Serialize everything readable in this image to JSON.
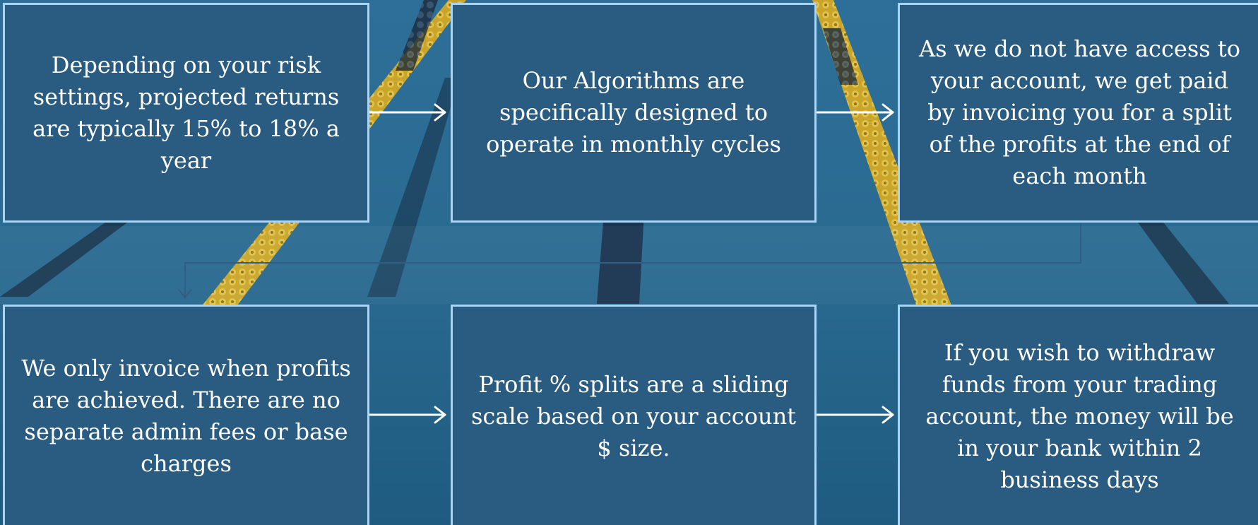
{
  "steps": [
    {
      "text": "Depending on your risk settings, projected returns are typically 15% to 18% a year"
    },
    {
      "text": "Our Algorithms are specifically designed to operate in monthly cycles"
    },
    {
      "text": "As we do not have access to your account, we get paid by invoicing you for a split of the profits at the end of each month"
    },
    {
      "text": "We only invoice when profits are achieved. There are no separate admin fees or base charges"
    },
    {
      "text": "Profit % splits are a sliding scale based on your account $ size."
    },
    {
      "text": "If you wish to withdraw funds from your trading account, the money will be in your bank within 2 business days"
    }
  ],
  "colors": {
    "card_fill": "#2a5b80",
    "card_border": "#a8d4f5",
    "arrow": "#ffffff",
    "background_water": "#1f5f86"
  }
}
